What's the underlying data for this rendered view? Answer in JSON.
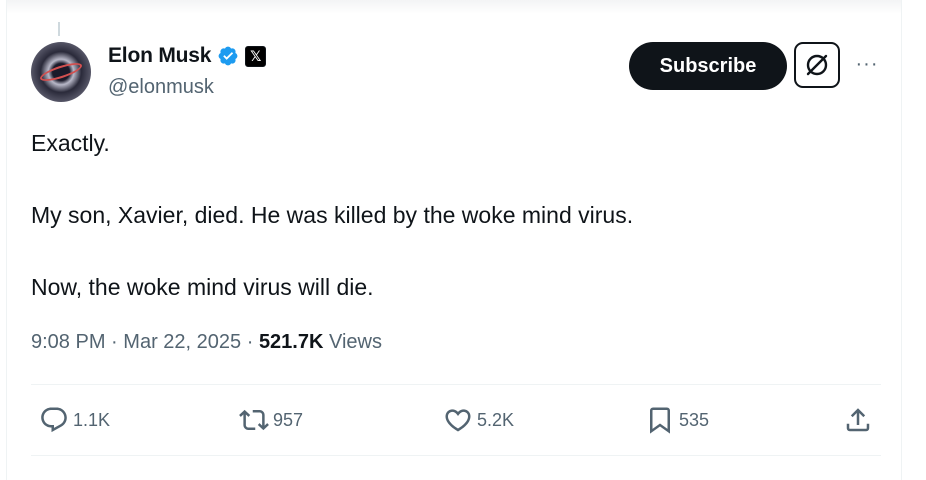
{
  "author": {
    "name": "Elon Musk",
    "handle": "@elonmusk"
  },
  "header": {
    "subscribe_label": "Subscribe"
  },
  "tweet": {
    "lines": [
      "Exactly.",
      "My son, Xavier, died. He was killed by the woke mind virus.",
      "Now, the woke mind virus will die."
    ],
    "time": "9:08 PM",
    "separator": "·",
    "date": "Mar 22, 2025",
    "views_count": "521.7K",
    "views_label": "Views"
  },
  "actions": {
    "replies": "1.1K",
    "reposts": "957",
    "likes": "5.2K",
    "bookmarks": "535"
  },
  "icons": {
    "verified": "verified-badge-icon",
    "affiliate": "x-logo-icon",
    "grok": "grok-icon",
    "more": "more-icon",
    "reply": "reply-icon",
    "repost": "repost-icon",
    "like": "heart-icon",
    "bookmark": "bookmark-icon",
    "share": "share-icon"
  },
  "colors": {
    "text_primary": "#0f1419",
    "text_secondary": "#536471",
    "verified_blue": "#1d9bf0",
    "button_dark": "#0f1419",
    "divider": "#eff3f4"
  }
}
